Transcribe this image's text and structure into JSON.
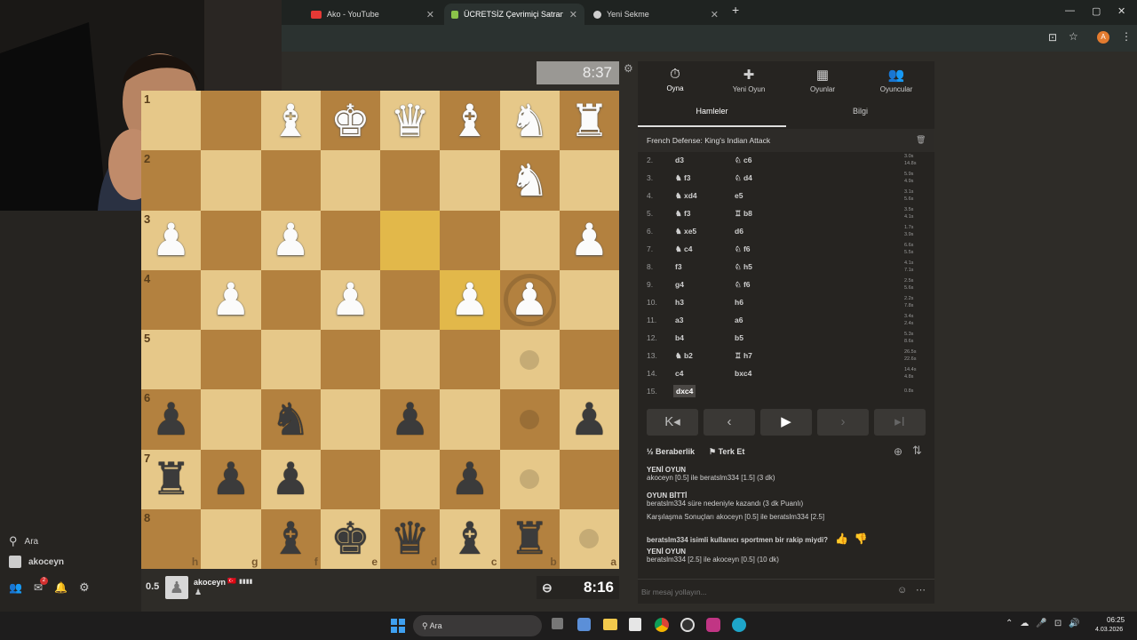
{
  "browser": {
    "tabs": [
      {
        "label": "Ako - YouTube",
        "color": "#e53935"
      },
      {
        "label": "ÜCRETSİZ Çevrimiçi Satranç Oy",
        "color": "#8bc34a"
      },
      {
        "label": "Yeni Sekme",
        "color": "#cfcfcf"
      }
    ],
    "new_tab": "+",
    "window_controls": [
      "—",
      "▢",
      "✕"
    ],
    "profile_letter": "A"
  },
  "sidebar": {
    "search_label": "Ara",
    "user_label": "akoceyn",
    "mail_badge": "2"
  },
  "board": {
    "rows": [
      [
        "",
        "",
        "B",
        "K",
        "Q",
        "B",
        "N",
        "R"
      ],
      [
        "",
        "",
        "",
        "",
        "",
        "",
        "N",
        ""
      ],
      [
        "P",
        "",
        "P",
        "",
        "",
        "",
        "",
        "P"
      ],
      [
        "",
        "P",
        "",
        "P",
        "",
        "P",
        "P",
        ""
      ],
      [
        "",
        "",
        "",
        "",
        "",
        "",
        "",
        ""
      ],
      [
        "p",
        "",
        "n",
        "",
        "p",
        "",
        "",
        "p"
      ],
      [
        "r",
        "p",
        "p",
        "",
        "",
        "p",
        "",
        ""
      ],
      [
        "",
        "",
        "b",
        "k",
        "q",
        "b",
        "r",
        ""
      ]
    ],
    "rank_labels": [
      "1",
      "2",
      "3",
      "4",
      "5",
      "6",
      "7",
      "8"
    ],
    "file_labels": [
      "h",
      "g",
      "f",
      "e",
      "d",
      "c",
      "b",
      "a"
    ],
    "highlighted": [
      "2-4",
      "3-5"
    ],
    "move_dots": [
      "4-6",
      "5-6",
      "6-6",
      "7-7"
    ],
    "capture_ring": [
      "3-6"
    ]
  },
  "clocks": {
    "top": "8:37",
    "bottom": "8:16"
  },
  "bottom_player": {
    "score": "0.5",
    "name": "akoceyn",
    "flag": "🇹🇷",
    "rating_bars": "▮▮▮▮"
  },
  "panel": {
    "nav": [
      {
        "icon": "⏱",
        "label": "Oyna"
      },
      {
        "icon": "✚",
        "label": "Yeni Oyun"
      },
      {
        "icon": "▦",
        "label": "Oyunlar"
      },
      {
        "icon": "👥",
        "label": "Oyuncular"
      }
    ],
    "tabs": [
      "Hamleler",
      "Bilgi"
    ],
    "opening": "French Defense: King's Indian Attack",
    "moves": [
      {
        "n": "2.",
        "w": "d3",
        "b": "♘ c6",
        "t1": "3.0s",
        "t2": "14.8s"
      },
      {
        "n": "3.",
        "w": "♞ f3",
        "b": "♘ d4",
        "t1": "5.9s",
        "t2": "4.9s"
      },
      {
        "n": "4.",
        "w": "♞ xd4",
        "b": "e5",
        "t1": "3.1s",
        "t2": "5.6s"
      },
      {
        "n": "5.",
        "w": "♞ f3",
        "b": "♖ b8",
        "t1": "3.5s",
        "t2": "4.1s"
      },
      {
        "n": "6.",
        "w": "♞ xe5",
        "b": "d6",
        "t1": "1.7s",
        "t2": "3.9s"
      },
      {
        "n": "7.",
        "w": "♞ c4",
        "b": "♘ f6",
        "t1": "6.6s",
        "t2": "5.5s"
      },
      {
        "n": "8.",
        "w": "f3",
        "b": "♘ h5",
        "t1": "4.1s",
        "t2": "7.1s"
      },
      {
        "n": "9.",
        "w": "g4",
        "b": "♘ f6",
        "t1": "2.5s",
        "t2": "5.6s"
      },
      {
        "n": "10.",
        "w": "h3",
        "b": "h6",
        "t1": "2.2s",
        "t2": "7.8s"
      },
      {
        "n": "11.",
        "w": "a3",
        "b": "a6",
        "t1": "3.4s",
        "t2": "2.4s"
      },
      {
        "n": "12.",
        "w": "b4",
        "b": "b5",
        "t1": "5.3s",
        "t2": "8.6s"
      },
      {
        "n": "13.",
        "w": "♞ b2",
        "b": "♖ h7",
        "t1": "26.5s",
        "t2": "22.6s"
      },
      {
        "n": "14.",
        "w": "c4",
        "b": "bxc4",
        "t1": "14.4s",
        "t2": "4.8s"
      },
      {
        "n": "15.",
        "w": "dxc4",
        "b": "",
        "t1": "0.8s",
        "t2": ""
      }
    ],
    "controls": [
      "K◂",
      "‹",
      "▶",
      "›",
      "▸I"
    ],
    "draw_label": "Beraberlik",
    "resign_label": "Terk Et",
    "chat": [
      {
        "head": "YENİ OYUN",
        "text": "akoceyn [0.5] ile beratslm334 [1.5] (3 dk)"
      },
      {
        "head": "OYUN BİTTİ",
        "text": "beratslm334 süre nedeniyle kazandı (3 dk Puanlı)"
      },
      {
        "head": "",
        "text": "Karşılaşma Sonuçları akoceyn [0.5] ile beratslm334 [2.5]"
      },
      {
        "head": "",
        "text": "beratslm334 isimli kullanıcı sportmen bir rakip miydi?"
      },
      {
        "head": "YENİ OYUN",
        "text": "beratslm334 [2.5] ile akoceyn [0.5] (10 dk)"
      }
    ],
    "message_placeholder": "Bir mesaj yollayın..."
  },
  "taskbar": {
    "search_label": "Ara",
    "time": "06:25",
    "date": "4.03.2026"
  }
}
